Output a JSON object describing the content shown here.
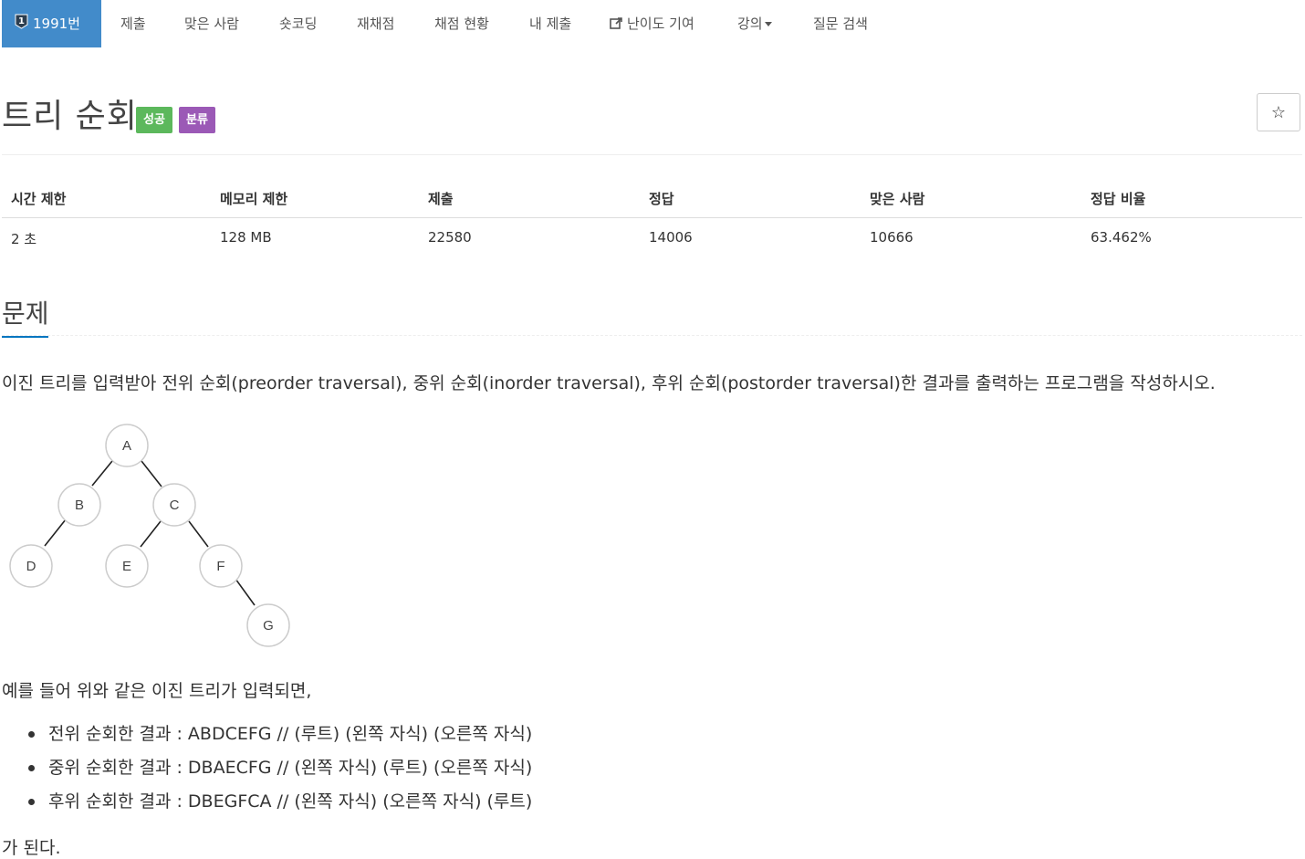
{
  "nav": {
    "problem_badge": "1",
    "problem_number": "1991번",
    "items": [
      "제출",
      "맞은 사람",
      "숏코딩",
      "재채점",
      "채점 현황",
      "내 제출",
      "난이도 기여",
      "강의",
      "질문 검색"
    ],
    "active_color": "#428bca"
  },
  "header": {
    "title": "트리 순회",
    "labels": [
      {
        "text": "성공",
        "color": "#5cb85c"
      },
      {
        "text": "분류",
        "color": "#9b59b6"
      }
    ],
    "star_icon": "☆"
  },
  "info_table": {
    "headers": [
      "시간 제한",
      "메모리 제한",
      "제출",
      "정답",
      "맞은 사람",
      "정답 비율"
    ],
    "values": [
      "2 초",
      "128 MB",
      "22580",
      "14006",
      "10666",
      "63.462%"
    ]
  },
  "section": {
    "title": "문제",
    "description": "이진 트리를 입력받아 전위 순회(preorder traversal), 중위 순회(inorder traversal), 후위 순회(postorder traversal)한 결과를 출력하는 프로그램을 작성하시오.",
    "tree_nodes": [
      "A",
      "B",
      "C",
      "D",
      "E",
      "F",
      "G"
    ],
    "example_intro": "예를 들어 위와 같은 이진 트리가 입력되면,",
    "results": [
      "전위 순회한 결과 : ABDCEFG // (루트) (왼쪽 자식) (오른쪽 자식)",
      "중위 순회한 결과 : DBAECFG // (왼쪽 자식) (루트) (오른쪽 자식)",
      "후위 순회한 결과 : DBEGFCA // (왼쪽 자식) (오른쪽 자식) (루트)"
    ],
    "conclusion": "가 된다."
  }
}
